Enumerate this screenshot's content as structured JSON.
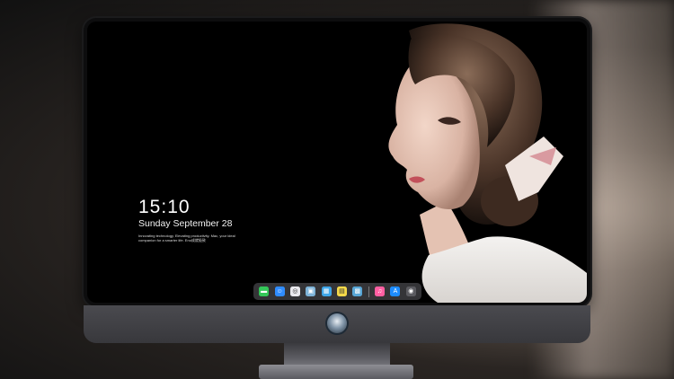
{
  "lockscreen": {
    "time": "15:10",
    "date": "Sunday September 28",
    "tagline": "Innovating technology, Elevating productivity. Mac, your ideal companion for a smarter life. Eno成就极致"
  },
  "dock": {
    "items": [
      {
        "name": "messages-icon",
        "color": "#34c759",
        "glyph": "▬"
      },
      {
        "name": "finder-icon",
        "color": "#2f8cff",
        "glyph": "☺"
      },
      {
        "name": "safari-icon",
        "color": "#e9e9ee",
        "glyph": "◎"
      },
      {
        "name": "preview-icon",
        "color": "#7fb4d8",
        "glyph": "▣"
      },
      {
        "name": "clapper-icon",
        "color": "#3fa6e8",
        "glyph": "▦"
      },
      {
        "name": "notes-icon",
        "color": "#f5d94a",
        "glyph": "▤"
      },
      {
        "name": "gallery-icon",
        "color": "#58a6d6",
        "glyph": "▩"
      },
      {
        "name": "music-icon",
        "color": "#ff5fa2",
        "glyph": "♫"
      },
      {
        "name": "app-store-icon",
        "color": "#1d8cff",
        "glyph": "A"
      },
      {
        "name": "camera-icon",
        "color": "#5b5b60",
        "glyph": "◉"
      }
    ]
  },
  "colors": {
    "screen_bg": "#000000",
    "bezel": "#0d0d0e",
    "chin": "#404044",
    "dock_bg": "#46464a"
  }
}
